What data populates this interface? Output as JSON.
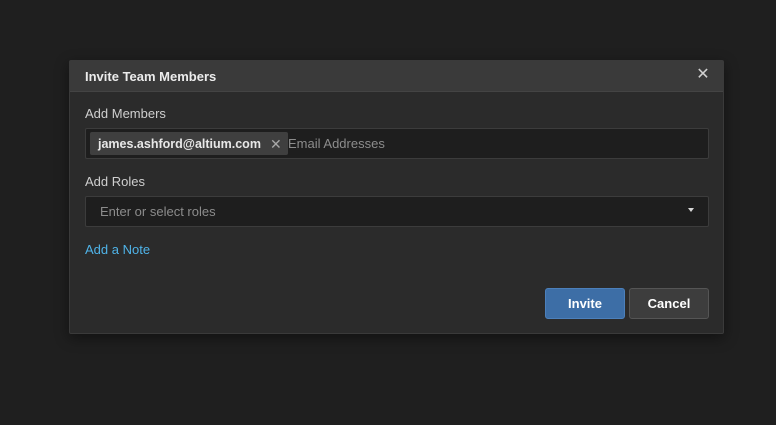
{
  "dialog": {
    "title": "Invite Team Members",
    "close_icon": "close-icon"
  },
  "members": {
    "label": "Add Members",
    "chips": [
      {
        "email": "james.ashford@altium.com",
        "remove_icon": "close-icon"
      }
    ],
    "input_value": "",
    "placeholder": "Email Addresses"
  },
  "roles": {
    "label": "Add Roles",
    "placeholder": "Enter or select roles",
    "caret_icon": "caret-down-icon"
  },
  "note_link": "Add a Note",
  "actions": {
    "invite_label": "Invite",
    "cancel_label": "Cancel"
  },
  "colors": {
    "background": "#1f1f1f",
    "dialog": "#2b2b2b",
    "header": "#3a3a3a",
    "accent_button": "#3d6ea6",
    "link": "#4fb3e8"
  }
}
